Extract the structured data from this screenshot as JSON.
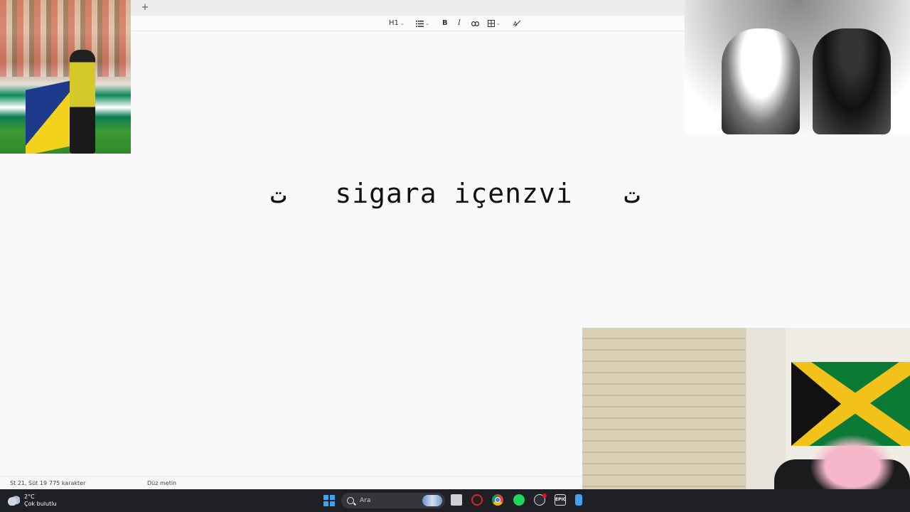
{
  "tabbar": {
    "add_tab_label": "+"
  },
  "toolbar": {
    "heading_label": "H1",
    "list_icon": "list-icon",
    "bold_label": "B",
    "italic_label": "I",
    "link_icon": "link-icon",
    "table_icon": "table-icon",
    "clear_format_icon": "clear-formatting-icon",
    "chevron": "⌄"
  },
  "editor": {
    "content": "ت   sigara içenzvi   ت"
  },
  "statusbar": {
    "position": "St 21, Süt 19",
    "char_count": "775 karakter",
    "format": "Düz metin"
  },
  "taskbar": {
    "temperature": "2°C",
    "weather_desc": "Çok bulutlu",
    "search_placeholder": "Ara",
    "epic_label": "EPIC",
    "accent_color": "#3ea3f0"
  }
}
